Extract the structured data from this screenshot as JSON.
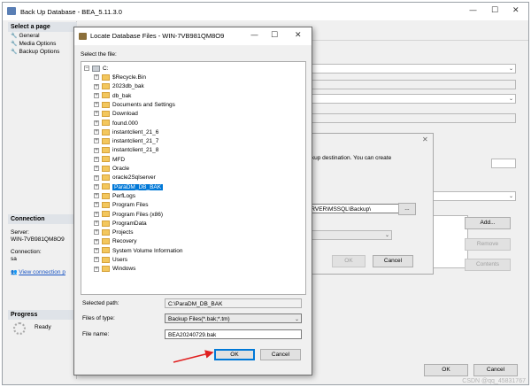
{
  "background_window": {
    "title": "Back Up Database - BEA_5.11.3.0",
    "select_page_header": "Select a page",
    "pages": [
      "General",
      "Media Options",
      "Backup Options"
    ],
    "connection_header": "Connection",
    "server_label": "Server:",
    "server_value": "WIN-7VB981QM8O9",
    "connection_label": "Connection:",
    "connection_value": "sa",
    "view_connection_link": "View connection p",
    "progress_header": "Progress",
    "progress_status": "Ready",
    "add_button": "Add...",
    "remove_button": "Remove",
    "contents_button": "Contents",
    "ok_button": "OK",
    "cancel_button": "Cancel"
  },
  "middle_dialog": {
    "text": "ackup destination. You can create",
    "path_text": "LSERVER\\MSSQL\\Backup\\",
    "browse_button": "...",
    "ok_button": "OK",
    "cancel_button": "Cancel"
  },
  "dialog": {
    "title": "Locate Database Files - WIN-7VB981QM8O9",
    "select_file_label": "Select the file:",
    "tree_root": "C:",
    "tree_items": [
      {
        "label": "$Recycle.Bin"
      },
      {
        "label": "2023db_bak"
      },
      {
        "label": "db_bak"
      },
      {
        "label": "Documents and Settings"
      },
      {
        "label": "Download"
      },
      {
        "label": "found.000"
      },
      {
        "label": "instantclient_21_6"
      },
      {
        "label": "instantclient_21_7"
      },
      {
        "label": "instantclient_21_8"
      },
      {
        "label": "MFD"
      },
      {
        "label": "Oracle"
      },
      {
        "label": "oracle2Sqlserver"
      },
      {
        "label": "ParaDM_DB_BAK"
      },
      {
        "label": "PerfLogs"
      },
      {
        "label": "Program Files"
      },
      {
        "label": "Program Files (x86)"
      },
      {
        "label": "ProgramData"
      },
      {
        "label": "Projects"
      },
      {
        "label": "Recovery"
      },
      {
        "label": "System Volume Information"
      },
      {
        "label": "Users"
      },
      {
        "label": "Windows"
      }
    ],
    "selected_path_label": "Selected path:",
    "selected_path_value": "C:\\ParaDM_DB_BAK",
    "files_of_type_label": "Files of type:",
    "files_of_type_value": "Backup Files(*.bak;*.tm)",
    "file_name_label": "File name:",
    "file_name_value": "BEA20240729.bak",
    "ok_button": "OK",
    "cancel_button": "Cancel"
  },
  "watermark": "CSDN @qq_45831767",
  "colors": {
    "selection": "#0078d7",
    "annotation_arrow": "#e02020",
    "folder": "#f3c75d"
  }
}
